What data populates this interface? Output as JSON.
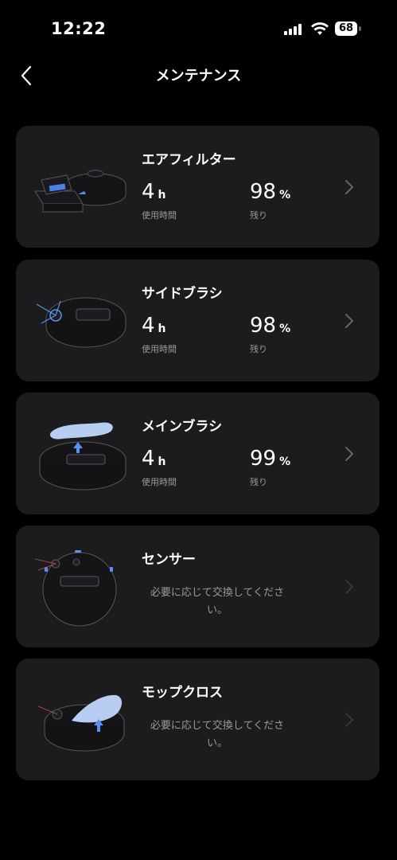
{
  "status_bar": {
    "time": "12:22",
    "battery": "68"
  },
  "header": {
    "title": "メンテナンス"
  },
  "cards": [
    {
      "title": "エアフィルター",
      "usage_value": "4",
      "usage_unit": "h",
      "usage_label": "使用時間",
      "remaining_value": "98",
      "remaining_unit": "%",
      "remaining_label": "残り"
    },
    {
      "title": "サイドブラシ",
      "usage_value": "4",
      "usage_unit": "h",
      "usage_label": "使用時間",
      "remaining_value": "98",
      "remaining_unit": "%",
      "remaining_label": "残り"
    },
    {
      "title": "メインブラシ",
      "usage_value": "4",
      "usage_unit": "h",
      "usage_label": "使用時間",
      "remaining_value": "99",
      "remaining_unit": "%",
      "remaining_label": "残り"
    },
    {
      "title": "センサー",
      "description": "必要に応じて交換してください。"
    },
    {
      "title": "モップクロス",
      "description": "必要に応じて交換してください。"
    }
  ],
  "colors": {
    "background": "#000000",
    "card": "#1c1c1e",
    "accent": "#5b8ff0",
    "muted_text": "#9a9a9a"
  }
}
